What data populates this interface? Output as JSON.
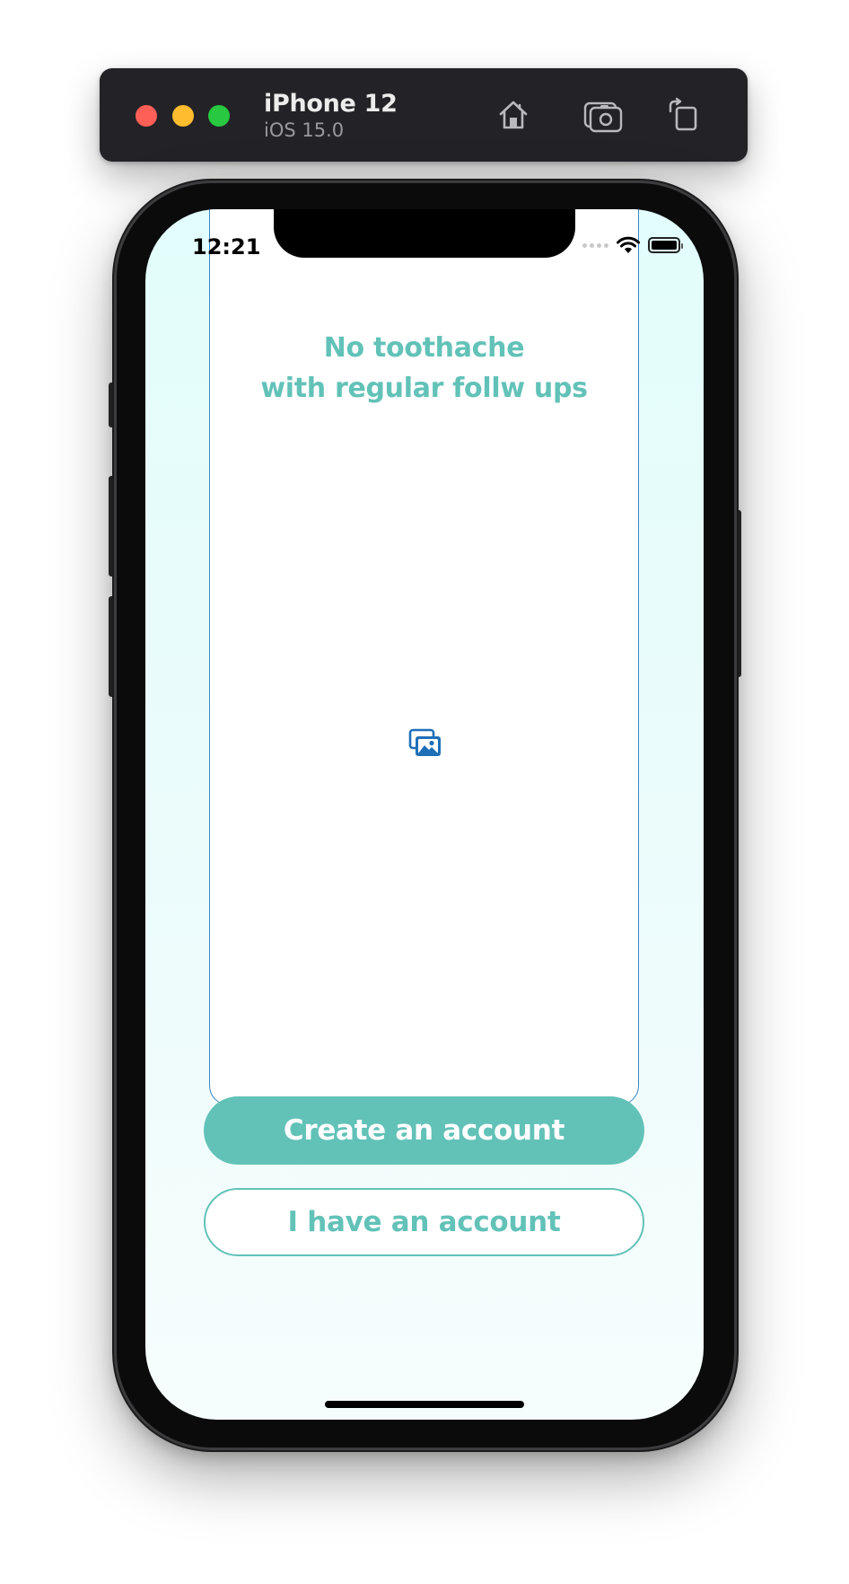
{
  "simulator": {
    "device_name": "iPhone 12",
    "os_version": "iOS 15.0",
    "toolbar_icons": [
      "home-icon",
      "screenshot-icon",
      "rotate-icon"
    ]
  },
  "status_bar": {
    "time": "12:21",
    "icons": [
      "cellular-signal-icon",
      "wifi-icon",
      "battery-icon"
    ]
  },
  "onboarding": {
    "headline_line1": "No toothache",
    "headline_line2": "with regular follw ups",
    "image_icon": "image-placeholder-icon"
  },
  "actions": {
    "primary_label": "Create an account",
    "secondary_label": "I have an account"
  },
  "colors": {
    "accent": "#62c2b8",
    "card_border": "#3c87c4",
    "screen_background": "#e2fdfb",
    "toolbar_background": "#232226"
  }
}
